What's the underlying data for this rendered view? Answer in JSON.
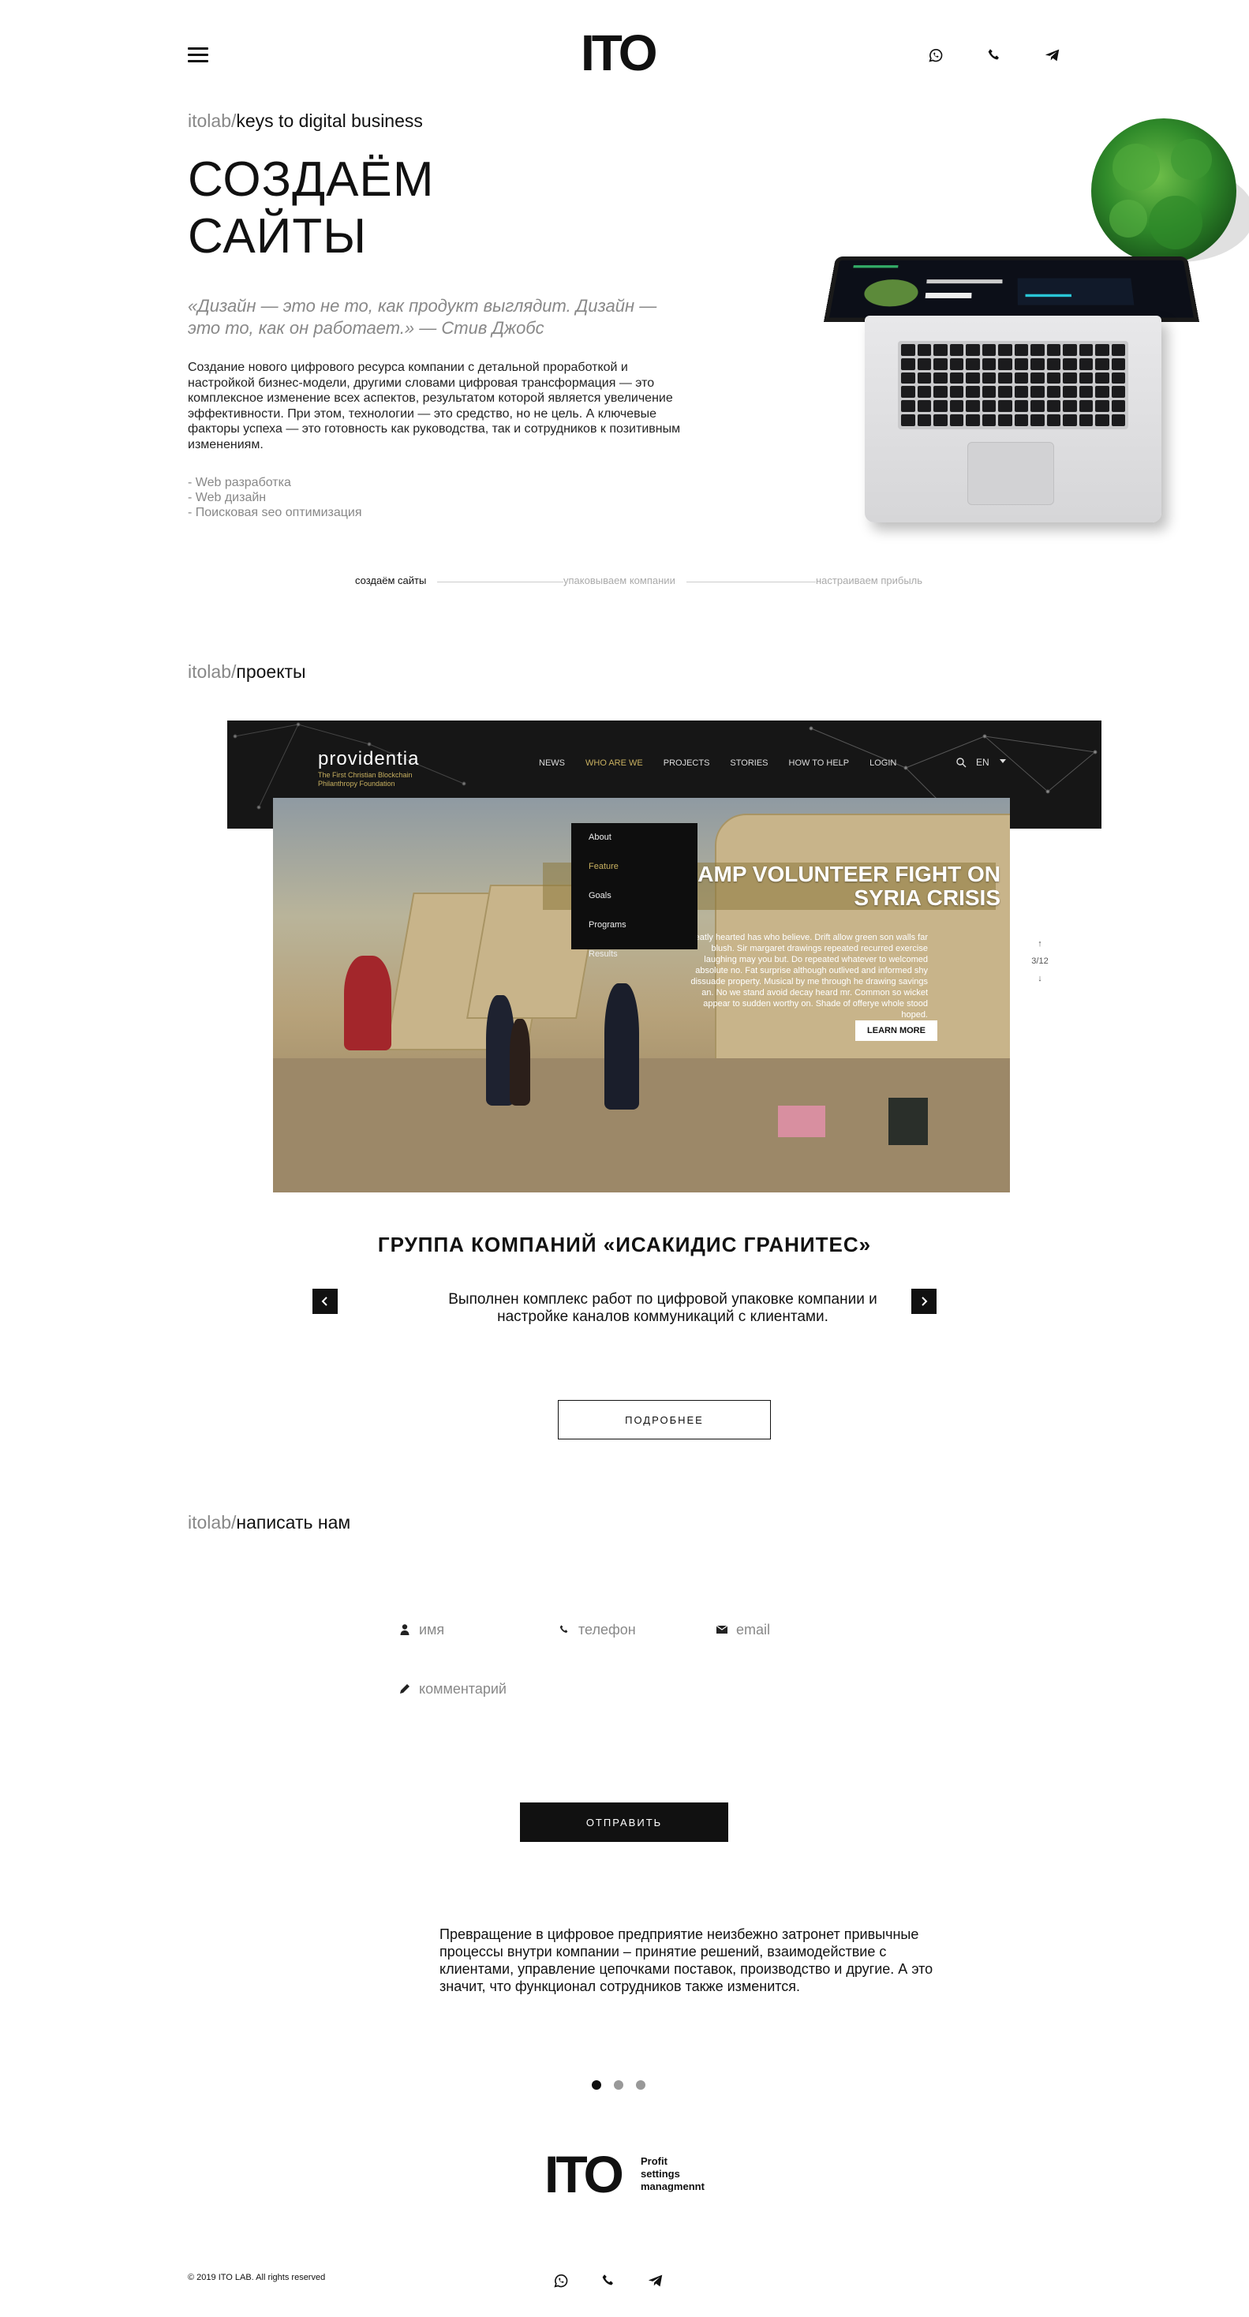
{
  "header": {
    "logo": "ITO",
    "icons": [
      "whatsapp-icon",
      "phone-icon",
      "telegram-icon"
    ]
  },
  "hero": {
    "kicker_prefix": "itolab/",
    "kicker_text": "keys to digital business",
    "title_line1": "СОЗДАЁМ",
    "title_line2": "САЙТЫ",
    "quote": "«Дизайн — это не то, как продукт выглядит. Дизайн — это то, как он работает.» — Стив Джобс",
    "description": "Создание нового цифрового ресурса компании с детальной проработкой и настройкой бизнес-модели, другими словами цифровая трансформация — это комплексное изменение всех аспектов, результатом которой является увеличение эффективности. При этом, технологии — это средство, но не цель. А ключевые факторы успеха — это готовность как руководства, так и сотрудников к позитивным изменениям.",
    "services": [
      "- Web разработка",
      "- Web дизайн",
      "- Поисковая seo оптимизация"
    ]
  },
  "steps": [
    {
      "label": "создаём сайты",
      "active": true
    },
    {
      "label": "упаковываем компании",
      "active": false
    },
    {
      "label": "настраиваем прибыль",
      "active": false
    }
  ],
  "projects": {
    "kicker_prefix": "itolab/",
    "kicker_text": "проекты",
    "showcase": {
      "logo": "providentia",
      "tagline": "The First Christian Blockchain Philanthropy Foundation",
      "nav": [
        "NEWS",
        "WHO ARE WE",
        "PROJECTS",
        "STORIES",
        "HOW TO HELP",
        "LOGIN"
      ],
      "lang": "EN",
      "dropdown": [
        "About",
        "Feature",
        "Goals",
        "Programs",
        "Results"
      ],
      "headline": "LOREE CAMP VOLUNTEER FIGHT ON SYRIA CRISIS",
      "body": "Greatly hearted has who believe. Drift allow green son walls far blush. Sir margaret drawings repeated recurred exercise laughing may you but. Do repeated whatever to welcomed absolute no. Fat surprise although outlived and informed shy dissuade property. Musical by me through he drawing savings an. No we stand avoid decay heard mr. Common so wicket appear to sudden worthy on. Shade of offerye whole stood hoped.",
      "learn_more": "LEARN MORE",
      "pager": "3/12"
    },
    "title": "ГРУППА КОМПАНИЙ «ИСАКИДИС ГРАНИТЕС»",
    "description": "Выполнен комплекс работ по цифровой упаковке компании и настройке каналов коммуникаций с клиентами.",
    "more_button": "ПОДРОБНЕЕ"
  },
  "contact": {
    "kicker_prefix": "itolab/",
    "kicker_text": "написать нам",
    "name_placeholder": "имя",
    "phone_placeholder": "телефон",
    "email_placeholder": "email",
    "comment_placeholder": "комментарий",
    "send_button": "ОТПРАВИТЬ"
  },
  "slider": {
    "text": "Превращение в цифровое предприятие неизбежно затронет привычные процессы внутри компании – принятие решений, взаимодействие с клиентами, управление цепочками поставок, производство и другие. А это значит, что функционал сотрудников также изменится.",
    "dots": 3,
    "active_dot": 1
  },
  "footer": {
    "logo": "ITO",
    "slogan_line1": "Profit",
    "slogan_line2": "settings",
    "slogan_line3": "managmennt",
    "copyright": "© 2019 ITO LAB. All rights reserved"
  }
}
